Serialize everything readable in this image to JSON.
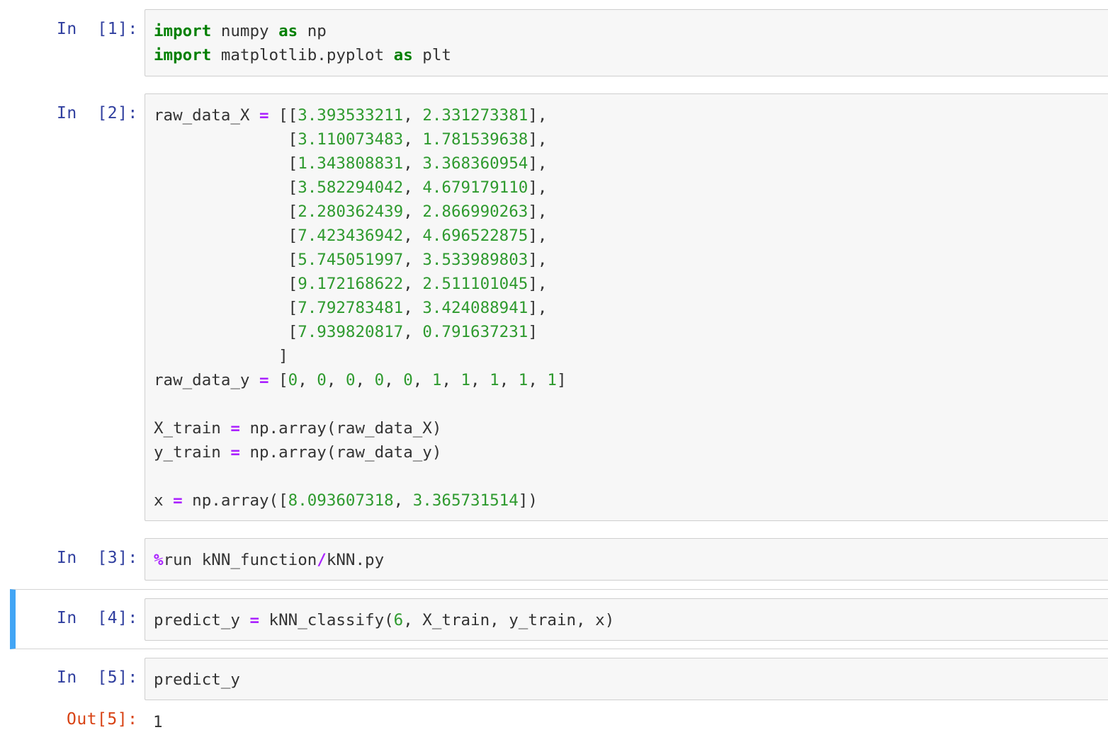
{
  "cells": [
    {
      "prompt": "In  [1]:",
      "lines": [
        "import numpy as np",
        "import matplotlib.pyplot as plt"
      ]
    },
    {
      "prompt": "In  [2]:",
      "lines": [
        "raw_data_X = [[3.393533211, 2.331273381],",
        "              [3.110073483, 1.781539638],",
        "              [1.343808831, 3.368360954],",
        "              [3.582294042, 4.679179110],",
        "              [2.280362439, 2.866990263],",
        "              [7.423436942, 4.696522875],",
        "              [5.745051997, 3.533989803],",
        "              [9.172168622, 2.511101045],",
        "              [7.792783481, 3.424088941],",
        "              [7.939820817, 0.791637231]",
        "             ]",
        "raw_data_y = [0, 0, 0, 0, 0, 1, 1, 1, 1, 1]",
        "",
        "X_train = np.array(raw_data_X)",
        "y_train = np.array(raw_data_y)",
        "",
        "x = np.array([8.093607318, 3.365731514])"
      ]
    },
    {
      "prompt": "In  [3]:",
      "lines": [
        "%run kNN_function/kNN.py"
      ]
    },
    {
      "prompt": "In  [4]:",
      "lines": [
        "predict_y = kNN_classify(6, X_train, y_train, x)"
      ]
    },
    {
      "prompt": "In  [5]:",
      "lines": [
        "predict_y"
      ]
    }
  ],
  "output": {
    "prompt": "Out[5]:",
    "value": "1"
  },
  "colors": {
    "selected_bar": "#42a5f5",
    "in_prompt": "#303f9f",
    "out_prompt": "#d84315",
    "keyword": "#008000",
    "operator": "#aa22ff",
    "number": "#2e9a2e"
  }
}
